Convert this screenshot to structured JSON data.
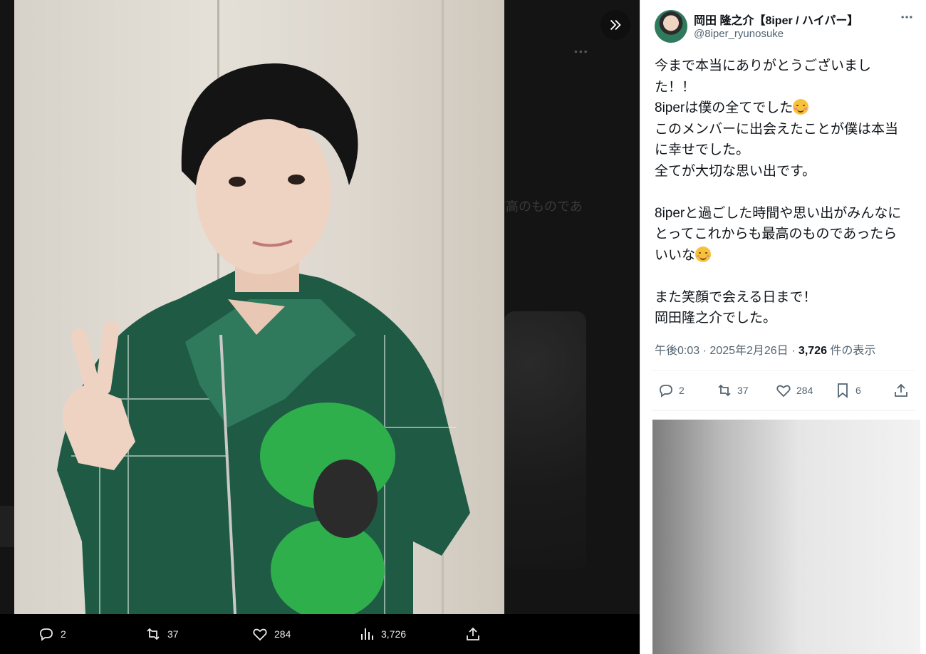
{
  "viewer": {
    "background_text": [
      "高のものであ"
    ],
    "actions": {
      "replies": "2",
      "retweets": "37",
      "likes": "284",
      "views": "3,726"
    }
  },
  "tweet": {
    "author_name": "岡田 隆之介【8iper / ハイパー】",
    "author_handle": "@8iper_ryunosuke",
    "lines": [
      "今まで本当にありがとうございまし",
      "た！！",
      "8iperは僕の全てでした",
      "このメンバーに出会えたことが僕は本当",
      "に幸せでした。",
      "全てが大切な思い出です。",
      "",
      "8iperと過ごした時間や思い出がみんなに",
      "とってこれからも最高のものであったら",
      "いいな",
      "",
      "また笑顔で会える日まで！",
      "岡田隆之介でした。"
    ],
    "meta": {
      "time": "午後0:03",
      "separator": "·",
      "date": "2025年2月26日",
      "views_count": "3,726",
      "views_label": "件の表示"
    },
    "stats": {
      "replies": "2",
      "retweets": "37",
      "likes": "284",
      "bookmarks": "6"
    }
  },
  "icons": [
    "expand-panel-icon",
    "reply-icon",
    "retweet-icon",
    "like-icon",
    "views-icon",
    "share-icon",
    "bookmark-icon",
    "more-icon"
  ],
  "colors": {
    "text": "#0f1419",
    "muted": "#536471",
    "viewer_bar": "#000000"
  }
}
